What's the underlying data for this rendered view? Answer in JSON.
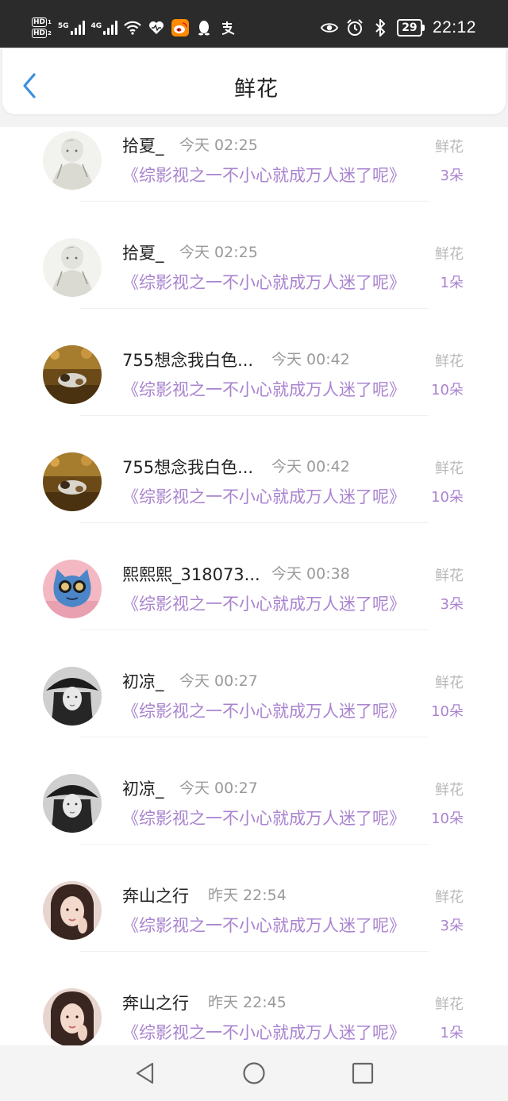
{
  "status_bar": {
    "hd_labels": [
      "HD",
      "HD"
    ],
    "hd_numbers": [
      "1",
      "2"
    ],
    "network_labels": [
      "5G",
      "4G"
    ],
    "battery": "29",
    "time": "22:12",
    "icons": [
      "wifi-icon",
      "heart-health-icon",
      "weibo-icon",
      "qq-penguin-icon",
      "alipay-icon",
      "eye-icon",
      "alarm-icon",
      "bluetooth-icon",
      "battery-icon"
    ]
  },
  "header": {
    "title": "鲜花",
    "back_icon": "chevron-left-icon"
  },
  "colors": {
    "accent_purple": "#a983cf",
    "back_blue": "#3d8fe0",
    "status_bg": "#2b2b2b",
    "muted_gray": "#9a9a9a"
  },
  "items": [
    {
      "name": "拾夏_",
      "time": "今天 02:25",
      "book": "《综影视之一不小心就成万人迷了呢》",
      "gift_type": "鲜花",
      "count": "3朵",
      "avatar": "sketch-girl-avatar"
    },
    {
      "name": "拾夏_",
      "time": "今天 02:25",
      "book": "《综影视之一不小心就成万人迷了呢》",
      "gift_type": "鲜花",
      "count": "1朵",
      "avatar": "sketch-girl-avatar"
    },
    {
      "name": "755想念我白色...",
      "time": "今天 00:42",
      "book": "《综影视之一不小心就成万人迷了呢》",
      "gift_type": "鲜花",
      "count": "10朵",
      "avatar": "cat-photo-avatar"
    },
    {
      "name": "755想念我白色...",
      "time": "今天 00:42",
      "book": "《综影视之一不小心就成万人迷了呢》",
      "gift_type": "鲜花",
      "count": "10朵",
      "avatar": "cat-photo-avatar"
    },
    {
      "name": "熙熙熙_318073...",
      "time": "今天 00:38",
      "book": "《综影视之一不小心就成万人迷了呢》",
      "gift_type": "鲜花",
      "count": "3朵",
      "avatar": "blue-cartoon-avatar"
    },
    {
      "name": "初凉_",
      "time": "今天 00:27",
      "book": "《综影视之一不小心就成万人迷了呢》",
      "gift_type": "鲜花",
      "count": "10朵",
      "avatar": "bw-hat-girl-avatar"
    },
    {
      "name": "初凉_",
      "time": "今天 00:27",
      "book": "《综影视之一不小心就成万人迷了呢》",
      "gift_type": "鲜花",
      "count": "10朵",
      "avatar": "bw-hat-girl-avatar"
    },
    {
      "name": "奔山之行",
      "time": "昨天 22:54",
      "book": "《综影视之一不小心就成万人迷了呢》",
      "gift_type": "鲜花",
      "count": "3朵",
      "avatar": "woman-photo-avatar"
    },
    {
      "name": "奔山之行",
      "time": "昨天 22:45",
      "book": "《综影视之一不小心就成万人迷了呢》",
      "gift_type": "鲜花",
      "count": "1朵",
      "avatar": "woman-photo-avatar"
    }
  ],
  "nav_bar": {
    "buttons": [
      "back-triangle-icon",
      "home-circle-icon",
      "recents-square-icon"
    ]
  }
}
